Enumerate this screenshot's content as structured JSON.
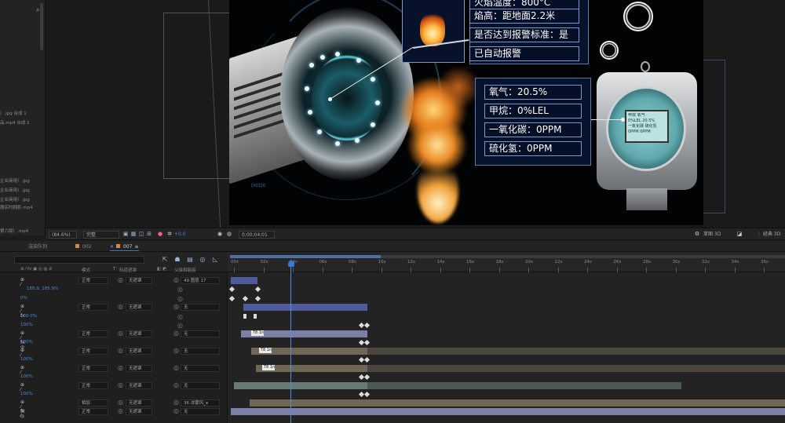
{
  "project": {
    "items": [
      "）.jpg 合成 1",
      "品.mp4 合成 1",
      "企业商用）.jpg",
      "企业商用）.jpg",
      "企业商用）.jpg",
      "器实时拥影.mp4",
      "第六版）.mp4"
    ]
  },
  "canvas": {
    "info_top": "火焰温度：800°C",
    "info_rows": [
      "焰高：距地面2.2米",
      "是否达到报警标准：是",
      "已自动报警"
    ],
    "gas_rows": [
      "氧气：20.5%",
      "甲烷：0%LEL",
      "一氧化碳：0PPM",
      "硫化氢：0PPM"
    ],
    "screen_lines": [
      "甲烷 氧气",
      "0%LEL 20.5%",
      "一氧化碳 硫化氢",
      "0PPM 0PPM"
    ],
    "hud_text": "DIS326"
  },
  "viewer_bar": {
    "zoom": "(84.6%)",
    "resolution": "完整",
    "plus_value": "+0.0",
    "timecode": "0;00;04;01",
    "camera_label": "草图 3D",
    "renderer": "经典 3D"
  },
  "tabs": {
    "render_queue": "渲染队列",
    "comp1": "002",
    "comp2": "007"
  },
  "columns": {
    "mode": "模式",
    "t": "T",
    "matte": "轨道遮罩",
    "parent": "父级和链接"
  },
  "layers": [
    {
      "mode": "正常",
      "matte": "无遮罩",
      "parent": "49.图层 17",
      "prop": "185.9, 185.9%",
      "prop2": "0%"
    },
    {
      "mode": "正常",
      "matte": "无遮罩",
      "parent": "无",
      "prop": "100.0%",
      "prop2": "100%"
    },
    {
      "mode": "正常",
      "matte": "无遮罩",
      "parent": "无",
      "prop": "100%"
    },
    {
      "mode": "正常",
      "matte": "无遮罩",
      "parent": "无",
      "prop": "100%"
    },
    {
      "mode": "正常",
      "matte": "无遮罩",
      "parent": "无",
      "prop": "100%"
    },
    {
      "mode": "正常",
      "matte": "无遮罩",
      "parent": "无",
      "prop": "100%"
    },
    {
      "mode": "相加",
      "matte": "无遮罩",
      "parent": "36.浓雾风_e"
    },
    {
      "mode": "正常",
      "matte": "无遮罩",
      "parent": "无"
    }
  ],
  "ruler": [
    "00s",
    "02s",
    "04s",
    "06s",
    "08s",
    "10s",
    "12s",
    "14s",
    "16s",
    "18s",
    "20s",
    "22s",
    "24s",
    "26s",
    "28s",
    "30s",
    "32s",
    "34s",
    "36s"
  ],
  "bar_labels": [
    "T8 1n",
    "T8 1n",
    "T8 1n"
  ],
  "colors": {
    "accent": "#3a7ad6",
    "panel_bg": "#232323",
    "bar_blue": "#4f5b9a",
    "bar_tan": "#6f6656",
    "bar_teal": "#677a76",
    "bar_gray": "#7d80a6"
  }
}
